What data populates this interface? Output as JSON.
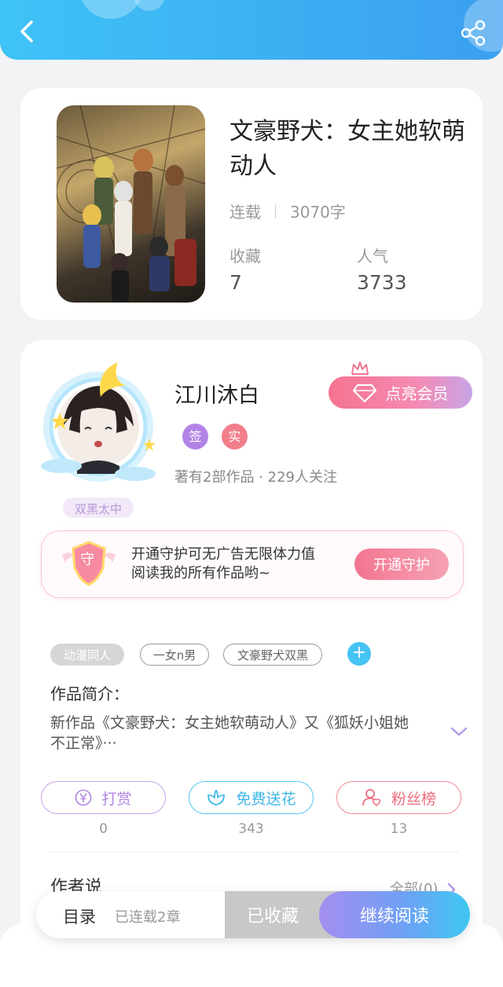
{
  "colors": {
    "header_start": "#3fc3f6",
    "header_end": "#3b9ff0",
    "accent_pink": "#f27590",
    "accent_blue": "#46c3f3",
    "accent_purple": "#a48ef0"
  },
  "header": {
    "back_icon": "chevron-left-icon",
    "share_icon": "share-icon"
  },
  "book": {
    "title": "文豪野犬：女主她软萌动人",
    "status": "连载",
    "word_count": "3070字",
    "favorites_label": "收藏",
    "favorites_value": "7",
    "popularity_label": "人气",
    "popularity_value": "3733"
  },
  "author": {
    "name": "江川沐白",
    "badge_signed": "签",
    "badge_verified": "实",
    "stats": "著有2部作品 · 229人关注",
    "avatar_tag": "双黑太中",
    "vip_button": "点亮会员"
  },
  "guard": {
    "icon_text": "守",
    "text": "开通守护可无广告无限体力值阅读我的所有作品哟~",
    "button": "开通守护"
  },
  "tags": [
    "动漫同人",
    "一女n男",
    "文豪野犬双黑"
  ],
  "intro": {
    "label": "作品简介：",
    "text": "新作品《文豪野犬：女主她软萌动人》又《狐妖小姐她不正常》···"
  },
  "actions": [
    {
      "label": "打赏",
      "count": "0",
      "icon": "yen-icon"
    },
    {
      "label": "免费送花",
      "count": "343",
      "icon": "flower-icon"
    },
    {
      "label": "粉丝榜",
      "count": "13",
      "icon": "fan-icon"
    }
  ],
  "author_says": {
    "label": "作者说",
    "all_link": "全部(0)"
  },
  "bottom_bar": {
    "toc": "目录",
    "chapter_status": "已连载2章",
    "favorited": "已收藏",
    "continue_reading": "继续阅读"
  }
}
